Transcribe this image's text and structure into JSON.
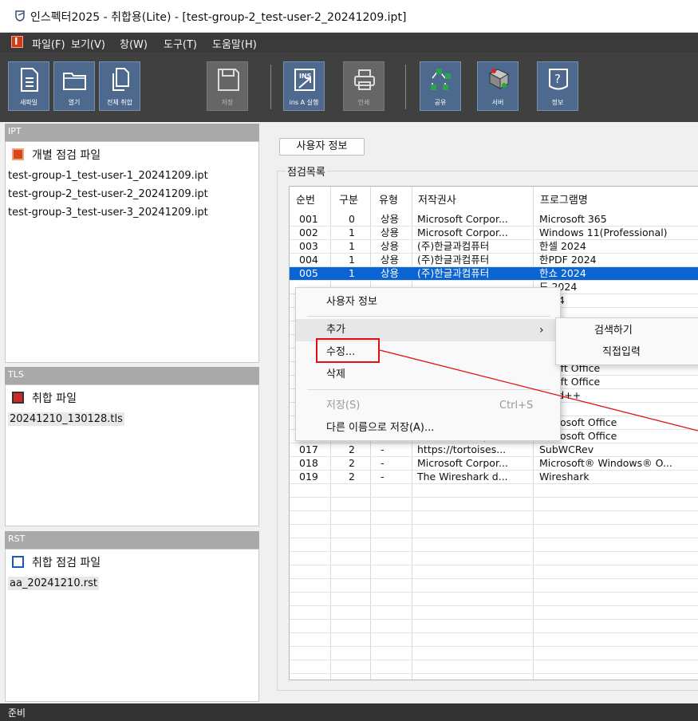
{
  "window": {
    "title": "인스펙터2025 - 취합용(Lite) - [test-group-2_test-user-2_20241209.ipt]"
  },
  "menu": [
    "파일(F)",
    "보기(V)",
    "창(W)",
    "도구(T)",
    "도움말(H)"
  ],
  "toolbar": {
    "buttons": [
      {
        "label": "새파일",
        "icon": "new-file-icon",
        "enabled": true
      },
      {
        "label": "열기",
        "icon": "open-folder-icon",
        "enabled": true
      },
      {
        "label": "전체 취합",
        "icon": "merge-files-icon",
        "enabled": true
      },
      {
        "label": "저장",
        "icon": "save-icon",
        "enabled": false
      },
      {
        "label": "ins A 실행",
        "icon": "run-ins-icon",
        "enabled": true
      },
      {
        "label": "인쇄",
        "icon": "print-icon",
        "enabled": false
      },
      {
        "label": "공유",
        "icon": "share-network-icon",
        "enabled": true
      },
      {
        "label": "서버",
        "icon": "server-icon",
        "enabled": true
      },
      {
        "label": "정보",
        "icon": "info-icon",
        "enabled": true
      }
    ]
  },
  "panels": {
    "ipt": {
      "header": "IPT",
      "type_label": "개별 점검 파일",
      "icon_letter": "I",
      "files": [
        "test-group-1_test-user-1_20241209.ipt",
        "test-group-2_test-user-2_20241209.ipt",
        "test-group-3_test-user-3_20241209.ipt"
      ]
    },
    "tls": {
      "header": "TLS",
      "type_label": "취합 파일",
      "icon_letter": "T",
      "files": [
        "20241210_130128.tls"
      ]
    },
    "rst": {
      "header": "RST",
      "type_label": "취합 점검 파일",
      "icon_letter": "R",
      "files": [
        "aa_20241210.rst"
      ]
    }
  },
  "main": {
    "user_info_button": "사용자 정보",
    "list_label": "점검목록",
    "columns": [
      "순번",
      "구분",
      "유형",
      "저작권사",
      "프로그램명"
    ],
    "rows": [
      {
        "no": "001",
        "cat": "0",
        "type": "상용",
        "vendor": "Microsoft Corpor...",
        "program": "Microsoft 365"
      },
      {
        "no": "002",
        "cat": "1",
        "type": "상용",
        "vendor": "Microsoft Corpor...",
        "program": "Windows 11(Professional)"
      },
      {
        "no": "003",
        "cat": "1",
        "type": "상용",
        "vendor": "(주)한글과컴퓨터",
        "program": "한셀 2024"
      },
      {
        "no": "004",
        "cat": "1",
        "type": "상용",
        "vendor": "(주)한글과컴퓨터",
        "program": "한PDF 2024"
      },
      {
        "no": "005",
        "cat": "1",
        "type": "상용",
        "vendor": "(주)한글과컴퓨터",
        "program": "한쇼 2024"
      },
      {
        "no": "",
        "cat": "",
        "type": "",
        "vendor": "",
        "program": "드 2024"
      },
      {
        "no": "",
        "cat": "",
        "type": "",
        "vendor": "",
        "program": "2024"
      },
      {
        "no": "",
        "cat": "",
        "type": "",
        "vendor": "",
        "program": ""
      },
      {
        "no": "",
        "cat": "",
        "type": "",
        "vendor": "",
        "program": ""
      },
      {
        "no": "",
        "cat": "",
        "type": "",
        "vendor": "",
        "program": ""
      },
      {
        "no": "",
        "cat": "",
        "type": "",
        "vendor": "",
        "program": "rosoft Office"
      },
      {
        "no": "",
        "cat": "",
        "type": "",
        "vendor": "",
        "program": "rosoft Office"
      },
      {
        "no": "",
        "cat": "",
        "type": "",
        "vendor": "",
        "program": "rosoft Office"
      },
      {
        "no": "",
        "cat": "",
        "type": "",
        "vendor": "",
        "program": "epad++"
      },
      {
        "no": "",
        "cat": "",
        "type": "",
        "vendor": "",
        "program": "udio"
      },
      {
        "no": "015",
        "cat": "2",
        "type": "-",
        "vendor": "Microsoft Corpor...",
        "program": "Microsoft Office"
      },
      {
        "no": "016",
        "cat": "2",
        "type": "-",
        "vendor": "Microsoft Corpor...",
        "program": "Microsoft Office"
      },
      {
        "no": "017",
        "cat": "2",
        "type": "-",
        "vendor": "https://tortoises...",
        "program": "SubWCRev"
      },
      {
        "no": "018",
        "cat": "2",
        "type": "-",
        "vendor": "Microsoft Corpor...",
        "program": "Microsoft® Windows® O..."
      },
      {
        "no": "019",
        "cat": "2",
        "type": "-",
        "vendor": "The Wireshark d...",
        "program": "Wireshark"
      }
    ],
    "selected_row_index": 4
  },
  "context_menu": {
    "user_info": "사용자 정보",
    "add": "추가",
    "edit": "수정...",
    "delete": "삭제",
    "save": "저장(S)",
    "save_shortcut": "Ctrl+S",
    "save_as": "다른 이름으로 저장(A)..."
  },
  "submenu": {
    "search": "검색하기",
    "direct_input": "직접입력"
  },
  "status": {
    "text": "준비"
  },
  "colors": {
    "selection": "#0a64d4",
    "annotation": "#e01010",
    "toolbar_button": "#4d6a8e"
  }
}
